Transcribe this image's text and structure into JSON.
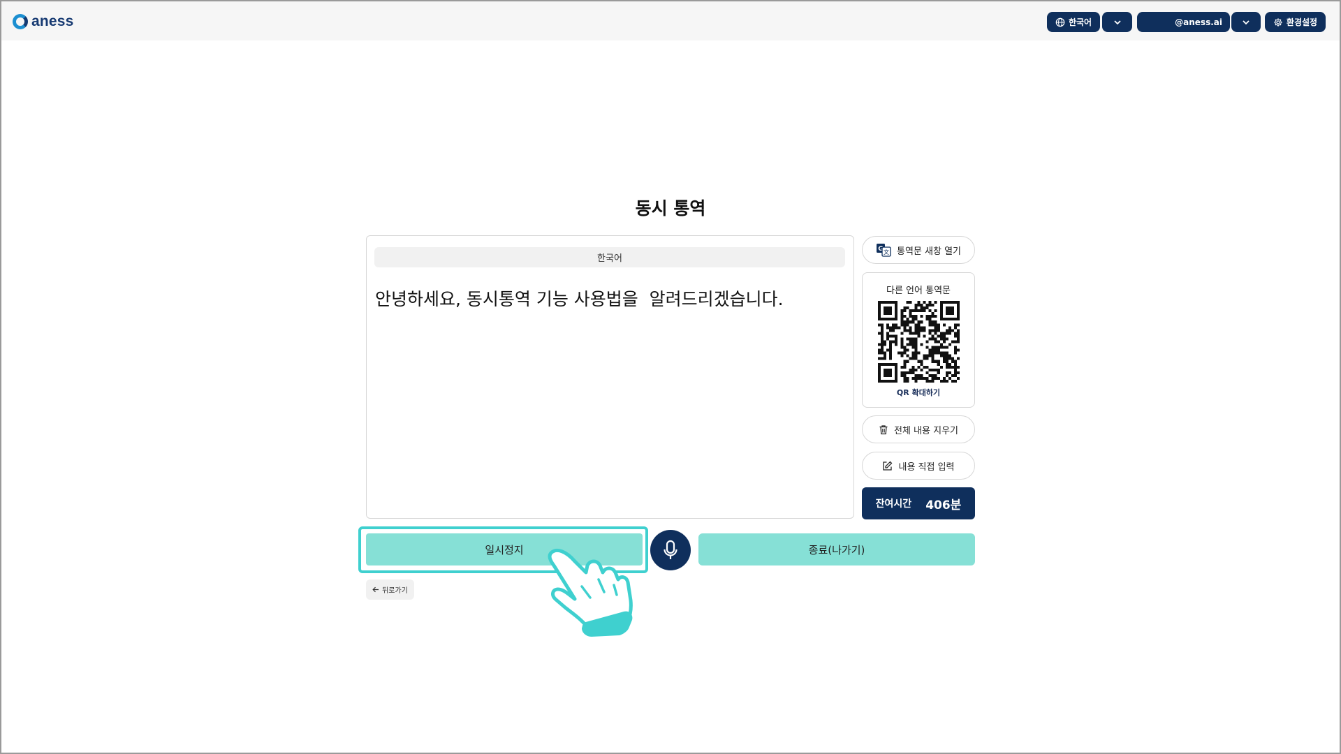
{
  "header": {
    "logo_text": "aness",
    "language_label": "한국어",
    "account_label": "@aness.ai",
    "settings_label": "환경설정"
  },
  "main": {
    "title": "동시 통역",
    "panel": {
      "language": "한국어",
      "transcript": "안녕하세요, 동시통역 기능 사용법을  알려드리겠습니다."
    },
    "side": {
      "new_window_label": "통역문 새창 열기",
      "qr_title": "다른 언어 통역문",
      "qr_enlarge_label": "QR 확대하기",
      "clear_label": "전체 내용 지우기",
      "manual_input_label": "내용 직접 입력",
      "remaining_label": "잔여시간",
      "remaining_value": "406분"
    },
    "controls": {
      "pause_label": "일시정지",
      "end_label": "종료(나가기)",
      "back_label": "뒤로가기"
    }
  },
  "colors": {
    "navy": "#0f2f5c",
    "mint": "#86e0d6",
    "highlight": "#3fd0cf"
  },
  "icons": [
    "globe-icon",
    "chevron-down-icon",
    "gear-icon",
    "translate-icon",
    "trash-icon",
    "edit-icon",
    "microphone-icon",
    "arrow-left-icon",
    "pointing-hand-icon"
  ]
}
